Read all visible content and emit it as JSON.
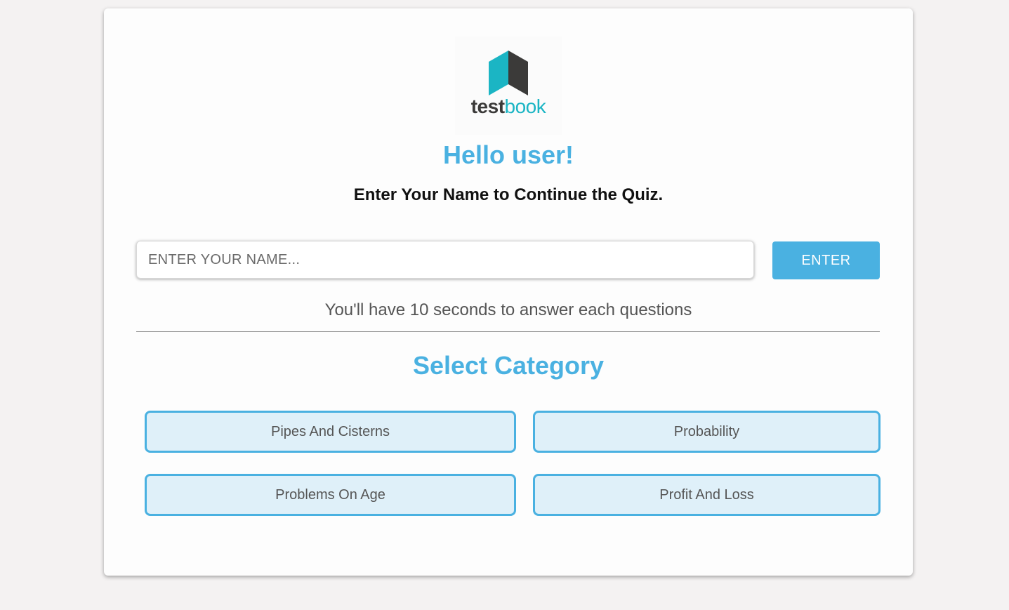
{
  "brand": {
    "logo_part1": "test",
    "logo_part2": "book",
    "colors": {
      "teal": "#1bb5c4",
      "dark": "#3b3a39"
    }
  },
  "greeting": "Hello user!",
  "instruction": "Enter Your Name to Continue the Quiz.",
  "name_input": {
    "placeholder": "ENTER YOUR NAME...",
    "value": ""
  },
  "enter_button": "ENTER",
  "timer_note": "You'll have 10 seconds to answer each questions",
  "category_section": {
    "title": "Select Category",
    "categories": [
      {
        "label": "Pipes And Cisterns"
      },
      {
        "label": "Probability"
      },
      {
        "label": "Problems On Age"
      },
      {
        "label": "Profit And Loss"
      }
    ]
  },
  "theme": {
    "accent": "#4ab1e1",
    "button_bg": "#dff0f9",
    "page_bg": "#f4f2f2"
  }
}
